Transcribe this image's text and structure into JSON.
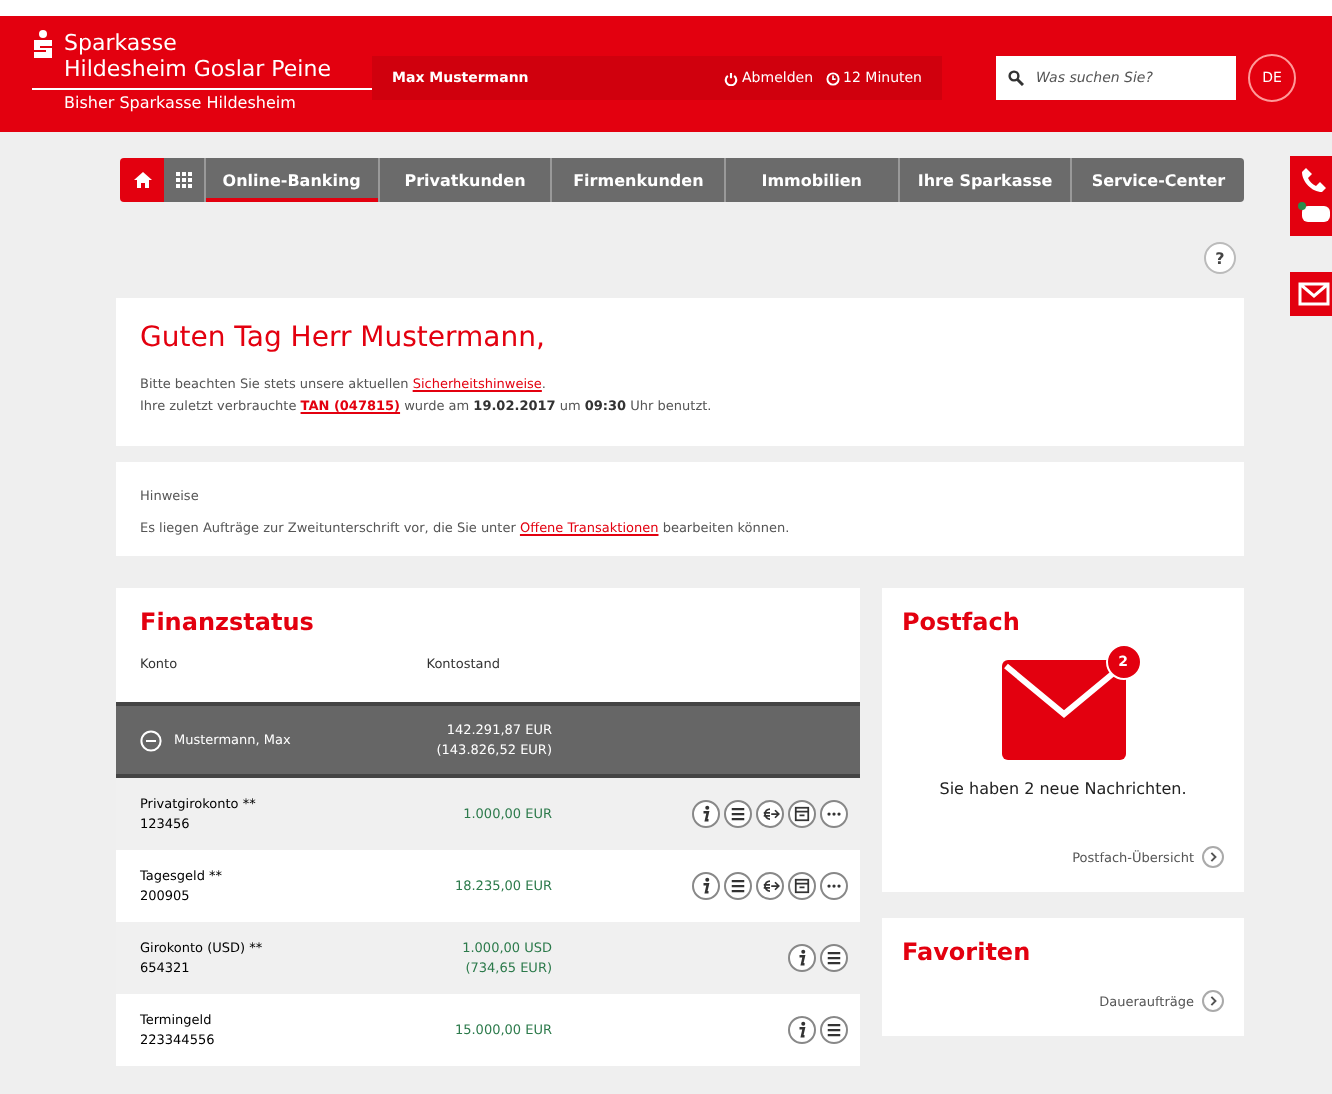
{
  "header": {
    "brand_line1": "Sparkasse",
    "brand_line2": "Hildesheim Goslar Peine",
    "brand_sub": "Bisher Sparkasse Hildesheim",
    "user": "Max Mustermann",
    "logout": "Abmelden",
    "timer": "12 Minuten",
    "search": {
      "placeholder": "Was suchen Sie?"
    },
    "language": "DE"
  },
  "nav": {
    "items": [
      {
        "label": "Online-Banking",
        "selected": true
      },
      {
        "label": "Privatkunden",
        "selected": false
      },
      {
        "label": "Firmenkunden",
        "selected": false
      },
      {
        "label": "Immobilien",
        "selected": false
      },
      {
        "label": "Ihre Sparkasse",
        "selected": false
      },
      {
        "label": "Service-Center",
        "selected": false
      }
    ]
  },
  "help": "?",
  "greeting": {
    "title": "Guten Tag Herr Mustermann,",
    "lines": [
      [
        {
          "kind": "text",
          "text": "Bitte beachten Sie stets unsere aktuellen "
        },
        {
          "kind": "link",
          "text": "Sicherheitshinweise"
        },
        {
          "kind": "text",
          "text": "."
        }
      ],
      [
        {
          "kind": "text",
          "text": "Ihre zuletzt verbrauchte "
        },
        {
          "kind": "link",
          "text": "TAN (047815)"
        },
        {
          "kind": "text",
          "text": " wurde am **19.02.2017** um **09:30** Uhr benutzt."
        }
      ]
    ]
  },
  "notice": {
    "title": "Hinweise",
    "line": [
      {
        "kind": "text",
        "text": "Es liegen Aufträge zur Zweitunterschrift vor, die Sie unter "
      },
      {
        "kind": "link",
        "text": "Offene Transaktionen"
      },
      {
        "kind": "text",
        "text": " bearbeiten können."
      }
    ]
  },
  "finanzstatus": {
    "title": "Finanzstatus",
    "columns": [
      "Konto",
      "Kontostand"
    ],
    "group": {
      "name": "Mustermann, Max",
      "expanded": true,
      "balance": "142.291,87 EUR",
      "balance_sub": "(143.826,52 EUR)"
    },
    "accounts": [
      {
        "name": "Privatgirokonto **",
        "number": "123456",
        "balance": "1.000,00 EUR",
        "actions": [
          {
            "kind": "info"
          },
          {
            "kind": "list"
          },
          {
            "kind": "transfer"
          },
          {
            "kind": "calendar"
          },
          {
            "kind": "more"
          }
        ]
      },
      {
        "name": "Tagesgeld **",
        "number": "200905",
        "balance": "18.235,00 EUR",
        "actions": [
          {
            "kind": "info"
          },
          {
            "kind": "list"
          },
          {
            "kind": "transfer"
          },
          {
            "kind": "calendar"
          },
          {
            "kind": "more"
          }
        ]
      },
      {
        "name": "Girokonto (USD) **",
        "number": "654321",
        "balance": "1.000,00 USD",
        "balance_sub": "(734,65 EUR)",
        "actions": [
          {
            "kind": "info"
          },
          {
            "kind": "list"
          }
        ]
      },
      {
        "name": "Termingeld",
        "number": "223344556",
        "balance": "15.000,00 EUR",
        "actions": [
          {
            "kind": "info"
          },
          {
            "kind": "list"
          }
        ]
      }
    ]
  },
  "postfach": {
    "title": "Postfach",
    "badge": "2",
    "message": "Sie haben 2 neue Nachrichten.",
    "link": "Postfach-Übersicht"
  },
  "favoriten": {
    "title": "Favoriten",
    "link": "Daueraufträge"
  }
}
